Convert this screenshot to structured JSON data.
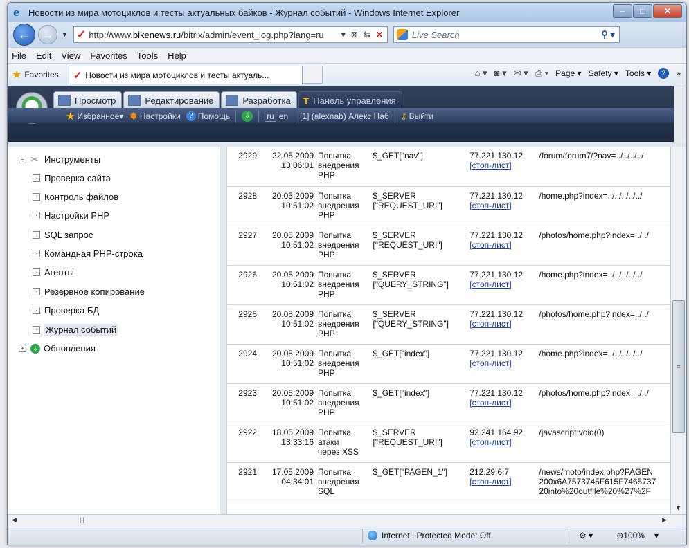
{
  "window": {
    "title": "Новости из мира мотоциклов и тесты актуальных байков - Журнал событий - Windows Internet Explorer"
  },
  "nav": {
    "url_prefix": "http://www.",
    "url_domain": "bikenews.ru",
    "url_rest": "/bitrix/admin/event_log.php?lang=ru",
    "search_placeholder": "Live Search"
  },
  "menu": [
    "File",
    "Edit",
    "View",
    "Favorites",
    "Tools",
    "Help"
  ],
  "favbar": {
    "favorites_label": "Favorites",
    "tab_title": "Новости из мира мотоциклов и тесты актуаль...",
    "page_label": "Page ▾",
    "safety_label": "Safety ▾",
    "tools_label": "Tools ▾"
  },
  "panel": {
    "tabs": [
      "Просмотр",
      "Редактирование",
      "Разработка",
      "Панель управления"
    ],
    "favorites": "Избранное",
    "settings": "Настройки",
    "help": "Помощь",
    "lang_ru": "ru",
    "lang_en": "en",
    "user": "[1] (alexnab) Алекс Наб",
    "logout": "Выйти"
  },
  "sidebar": {
    "root": "Инструменты",
    "items": [
      "Проверка сайта",
      "Контроль файлов",
      "Настройки PHP",
      "SQL запрос",
      "Командная PHP-строка",
      "Агенты",
      "Резервное копирование",
      "Проверка БД",
      "Журнал событий"
    ],
    "updates": "Обновления"
  },
  "log": {
    "stop_label": "[стоп-лист]",
    "rows": [
      {
        "id": "2929",
        "date": "22.05.2009",
        "time": "13:06:01",
        "type": [
          "Попытка",
          "внедрения",
          "PHP"
        ],
        "var": [
          "$_GET[\"nav\"]"
        ],
        "ip": "77.221.130.12",
        "url": [
          "/forum/forum7/?nav=../../../../"
        ]
      },
      {
        "id": "2928",
        "date": "20.05.2009",
        "time": "10:51:02",
        "type": [
          "Попытка",
          "внедрения",
          "PHP"
        ],
        "var": [
          "$_SERVER",
          "[\"REQUEST_URI\"]"
        ],
        "ip": "77.221.130.12",
        "url": [
          "/home.php?index=../../../../../"
        ]
      },
      {
        "id": "2927",
        "date": "20.05.2009",
        "time": "10:51:02",
        "type": [
          "Попытка",
          "внедрения",
          "PHP"
        ],
        "var": [
          "$_SERVER",
          "[\"REQUEST_URI\"]"
        ],
        "ip": "77.221.130.12",
        "url": [
          "/photos/home.php?index=../../"
        ]
      },
      {
        "id": "2926",
        "date": "20.05.2009",
        "time": "10:51:02",
        "type": [
          "Попытка",
          "внедрения",
          "PHP"
        ],
        "var": [
          "$_SERVER",
          "[\"QUERY_STRING\"]"
        ],
        "ip": "77.221.130.12",
        "url": [
          "/home.php?index=../../../../../"
        ]
      },
      {
        "id": "2925",
        "date": "20.05.2009",
        "time": "10:51:02",
        "type": [
          "Попытка",
          "внедрения",
          "PHP"
        ],
        "var": [
          "$_SERVER",
          "[\"QUERY_STRING\"]"
        ],
        "ip": "77.221.130.12",
        "url": [
          "/photos/home.php?index=../../"
        ]
      },
      {
        "id": "2924",
        "date": "20.05.2009",
        "time": "10:51:02",
        "type": [
          "Попытка",
          "внедрения",
          "PHP"
        ],
        "var": [
          "$_GET[\"index\"]"
        ],
        "ip": "77.221.130.12",
        "url": [
          "/home.php?index=../../../../../"
        ]
      },
      {
        "id": "2923",
        "date": "20.05.2009",
        "time": "10:51:02",
        "type": [
          "Попытка",
          "внедрения",
          "PHP"
        ],
        "var": [
          "$_GET[\"index\"]"
        ],
        "ip": "77.221.130.12",
        "url": [
          "/photos/home.php?index=../../"
        ]
      },
      {
        "id": "2922",
        "date": "18.05.2009",
        "time": "13:33:16",
        "type": [
          "Попытка",
          "атаки",
          "через XSS"
        ],
        "var": [
          "$_SERVER",
          "[\"REQUEST_URI\"]"
        ],
        "ip": "92.241.164.92",
        "url": [
          "/javascript:void(0)"
        ]
      },
      {
        "id": "2921",
        "date": "17.05.2009",
        "time": "04:34:01",
        "type": [
          "Попытка",
          "внедрения",
          "SQL"
        ],
        "var": [
          "$_GET[\"PAGEN_1\"]"
        ],
        "ip": "212.29.6.7",
        "url": [
          "/news/moto/index.php?PAGEN",
          "200x6A7573745F615F7465737",
          "20into%20outfile%20%27%2F"
        ]
      }
    ]
  },
  "status": {
    "zone": "Internet | Protected Mode: Off",
    "zoom": "100%"
  }
}
